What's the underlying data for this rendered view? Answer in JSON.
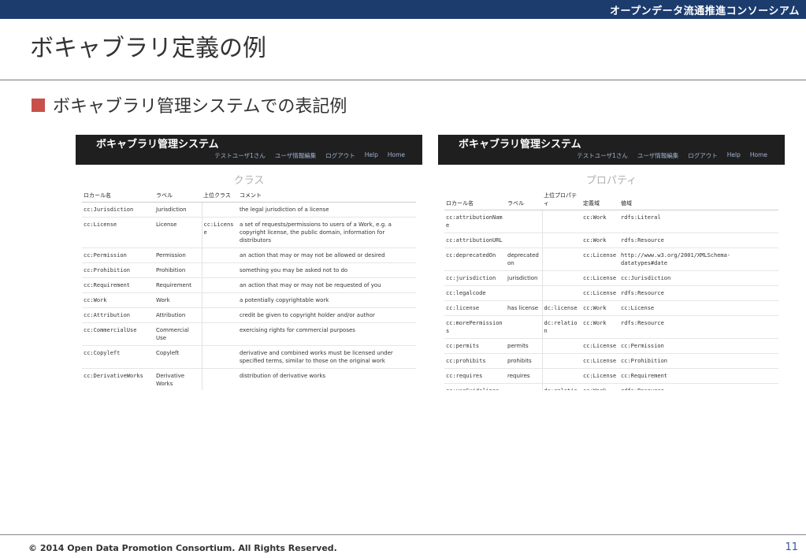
{
  "header": {
    "org": "オープンデータ流通推進コンソーシアム"
  },
  "title": "ボキャブラリ定義の例",
  "bullet": "ボキャブラリ管理システムでの表記例",
  "app": {
    "title": "ボキャブラリ管理システム",
    "nav": [
      "テストユーザ1さん",
      "ユーザ情報編集",
      "ログアウト",
      "Help",
      "Home"
    ]
  },
  "class_panel": {
    "heading": "クラス",
    "columns": [
      "ロカール名",
      "ラベル",
      "上位クラス",
      "コメント"
    ],
    "rows": [
      [
        "cc:Jurisdiction",
        "Jurisdiction",
        "",
        "the legal jurisdiction of a license"
      ],
      [
        "cc:License",
        "License",
        "cc:License",
        "a set of requests/permissions to users of a Work, e.g. a copyright license, the public domain, information for distributors"
      ],
      [
        "cc:Permission",
        "Permission",
        "",
        "an action that may or may not be allowed or desired"
      ],
      [
        "cc:Prohibition",
        "Prohibition",
        "",
        "something you may be asked not to do"
      ],
      [
        "cc:Requirement",
        "Requirement",
        "",
        "an action that may or may not be requested of you"
      ],
      [
        "cc:Work",
        "Work",
        "",
        "a potentially copyrightable work"
      ],
      [
        "cc:Attribution",
        "Attribution",
        "",
        "credit be given to copyright holder and/or author"
      ],
      [
        "cc:CommercialUse",
        "Commercial Use",
        "",
        "exercising rights for commercial purposes"
      ],
      [
        "cc:Copyleft",
        "Copyleft",
        "",
        "derivative and combined works must be licensed under specified terms, similar to those on the original work"
      ],
      [
        "cc:DerivativeWorks",
        "Derivative Works",
        "",
        "distribution of derivative works"
      ]
    ]
  },
  "property_panel": {
    "heading": "プロパティ",
    "columns": [
      "ロカール名",
      "ラベル",
      "上位プロパティ",
      "定義域",
      "値域"
    ],
    "rows": [
      [
        "cc:attributionName",
        "",
        "",
        "cc:Work",
        "rdfs:Literal"
      ],
      [
        "cc:attributionURL",
        "",
        "",
        "cc:Work",
        "rdfs:Resource"
      ],
      [
        "cc:deprecatedOn",
        "deprecated on",
        "",
        "cc:License",
        "http://www.w3.org/2001/XMLSchema-datatypes#date"
      ],
      [
        "cc:jurisdiction",
        "jurisdiction",
        "",
        "cc:License",
        "cc:Jurisdiction"
      ],
      [
        "cc:legalcode",
        "",
        "",
        "cc:License",
        "rdfs:Resource"
      ],
      [
        "cc:license",
        "has license",
        "dc:license",
        "cc:Work",
        "cc:License"
      ],
      [
        "cc:morePermissions",
        "",
        "dc:relation",
        "cc:Work",
        "rdfs:Resource"
      ],
      [
        "cc:permits",
        "permits",
        "",
        "cc:License",
        "cc:Permission"
      ],
      [
        "cc:prohibits",
        "prohibits",
        "",
        "cc:License",
        "cc:Prohibition"
      ],
      [
        "cc:requires",
        "requires",
        "",
        "cc:License",
        "cc:Requirement"
      ],
      [
        "cc:useGuidelines",
        "",
        "dc:relation",
        "cc:Work",
        "rdfs:Resource"
      ]
    ]
  },
  "footer": {
    "copyright": "© 2014 Open Data Promotion Consortium. All Rights Reserved.",
    "page": "11"
  }
}
